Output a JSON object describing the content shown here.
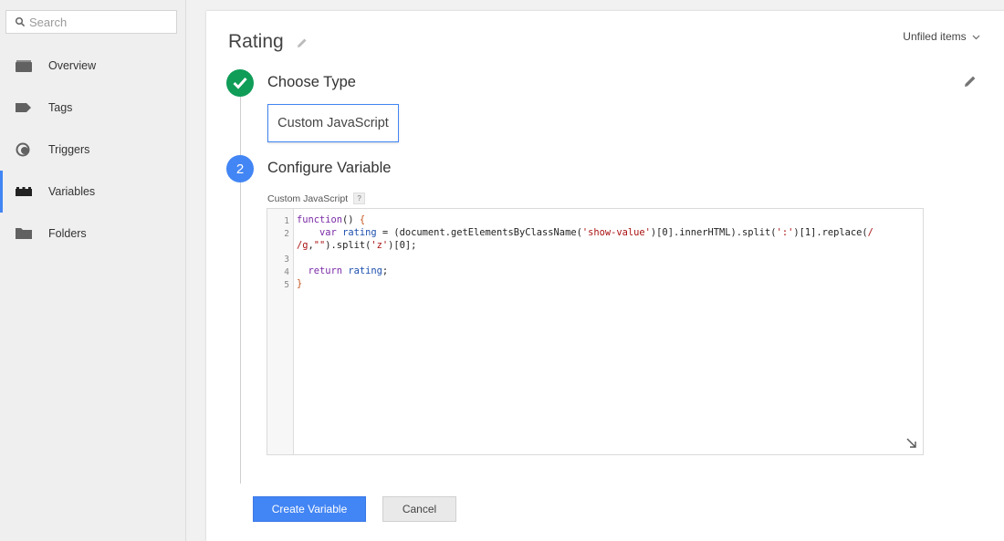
{
  "sidebar": {
    "search": {
      "placeholder": "Search"
    },
    "items": [
      {
        "label": "Overview",
        "icon": "overview-icon"
      },
      {
        "label": "Tags",
        "icon": "tag-icon"
      },
      {
        "label": "Triggers",
        "icon": "trigger-icon"
      },
      {
        "label": "Variables",
        "icon": "variables-icon",
        "active": true
      },
      {
        "label": "Folders",
        "icon": "folder-icon"
      }
    ]
  },
  "header": {
    "title": "Rating",
    "folder_selector": "Unfiled items"
  },
  "steps": {
    "choose_type": {
      "title": "Choose Type",
      "selected_type": "Custom JavaScript"
    },
    "configure": {
      "number": "2",
      "title": "Configure Variable",
      "field_label": "Custom JavaScript",
      "help": "?"
    }
  },
  "editor": {
    "line_numbers": [
      "1",
      "2",
      "",
      "3",
      "4",
      "5"
    ]
  },
  "actions": {
    "create_label": "Create Variable",
    "cancel_label": "Cancel"
  },
  "colors": {
    "accent": "#4285f4",
    "success": "#0f9d58"
  }
}
